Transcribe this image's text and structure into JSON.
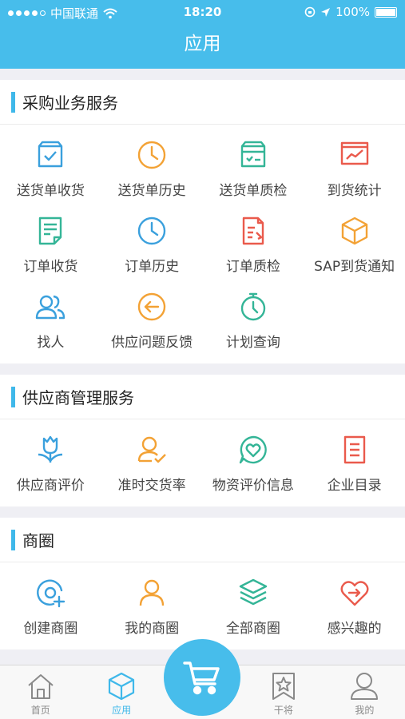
{
  "status": {
    "carrier": "中国联通",
    "time": "18:20",
    "battery": "100%"
  },
  "header": {
    "title": "应用"
  },
  "sections": [
    {
      "title": "采购业务服务",
      "items": [
        {
          "label": "送货单收货",
          "icon": "delivery-box-check-icon",
          "color": "#3aa0dd"
        },
        {
          "label": "送货单历史",
          "icon": "clock-icon",
          "color": "#f3a235"
        },
        {
          "label": "送货单质检",
          "icon": "delivery-inspection-icon",
          "color": "#34b597"
        },
        {
          "label": "到货统计",
          "icon": "line-chart-icon",
          "color": "#ea5a4c"
        },
        {
          "label": "订单收货",
          "icon": "order-document-icon",
          "color": "#34b597"
        },
        {
          "label": "订单历史",
          "icon": "clock-icon",
          "color": "#3aa0dd"
        },
        {
          "label": "订单质检",
          "icon": "order-inspection-icon",
          "color": "#ea5a4c"
        },
        {
          "label": "SAP到货通知",
          "icon": "cube-icon",
          "color": "#f3a235"
        },
        {
          "label": "找人",
          "icon": "people-icon",
          "color": "#3aa0dd"
        },
        {
          "label": "供应问题反馈",
          "icon": "back-arrow-circle-icon",
          "color": "#f3a235"
        },
        {
          "label": "计划查询",
          "icon": "stopwatch-icon",
          "color": "#34b597"
        }
      ]
    },
    {
      "title": "供应商管理服务",
      "items": [
        {
          "label": "供应商评价",
          "icon": "tulip-icon",
          "color": "#3aa0dd"
        },
        {
          "label": "准时交货率",
          "icon": "person-check-icon",
          "color": "#f3a235"
        },
        {
          "label": "物资评价信息",
          "icon": "heart-chat-icon",
          "color": "#34b597"
        },
        {
          "label": "企业目录",
          "icon": "list-document-icon",
          "color": "#ea5a4c"
        }
      ]
    },
    {
      "title": "商圈",
      "items": [
        {
          "label": "创建商圈",
          "icon": "create-circle-icon",
          "color": "#3aa0dd"
        },
        {
          "label": "我的商圈",
          "icon": "person-icon",
          "color": "#f3a235"
        },
        {
          "label": "全部商圈",
          "icon": "layers-icon",
          "color": "#34b597"
        },
        {
          "label": "感兴趣的",
          "icon": "heart-arrow-icon",
          "color": "#ea5a4c"
        }
      ]
    }
  ],
  "tabbar": {
    "items": [
      {
        "label": "首页",
        "icon": "home-icon",
        "active": false
      },
      {
        "label": "应用",
        "icon": "cube-icon",
        "active": true
      },
      {
        "label": "",
        "icon": "cart-icon",
        "active": false
      },
      {
        "label": "干将",
        "icon": "star-bookmark-icon",
        "active": false
      },
      {
        "label": "我的",
        "icon": "user-icon",
        "active": false
      }
    ]
  },
  "colors": {
    "brand": "#47bdeb",
    "accent": "#3fb8ea"
  }
}
